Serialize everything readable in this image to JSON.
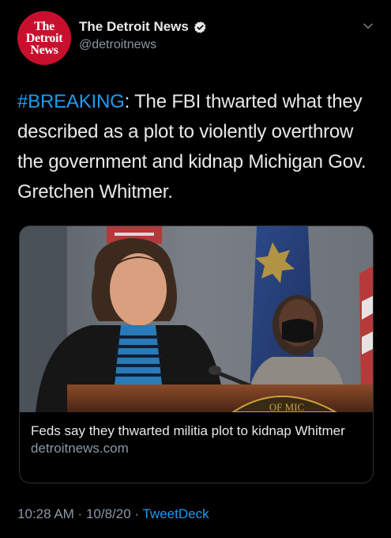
{
  "account": {
    "avatar_lines": [
      "The",
      "Detroit",
      "News"
    ],
    "display_name": "The Detroit News",
    "handle": "@detroitnews"
  },
  "tweet": {
    "hashtag": "#BREAKING",
    "text": ": The FBI thwarted what they described as a plot to violently overthrow the government and kidnap Michigan Gov. Gretchen Whitmer."
  },
  "card": {
    "title": "Feds say they thwarted militia plot to kidnap Whitmer",
    "domain": "detroitnews.com",
    "photo_seal_text": "OF MIC"
  },
  "meta": {
    "time": "10:28 AM",
    "separator1": " · ",
    "date": "10/8/20",
    "separator2": " · ",
    "source": "TweetDeck"
  },
  "colors": {
    "background": "#000000",
    "link": "#1d9bf0",
    "secondary_text": "#8b98a5",
    "avatar_red": "#c8102e"
  }
}
